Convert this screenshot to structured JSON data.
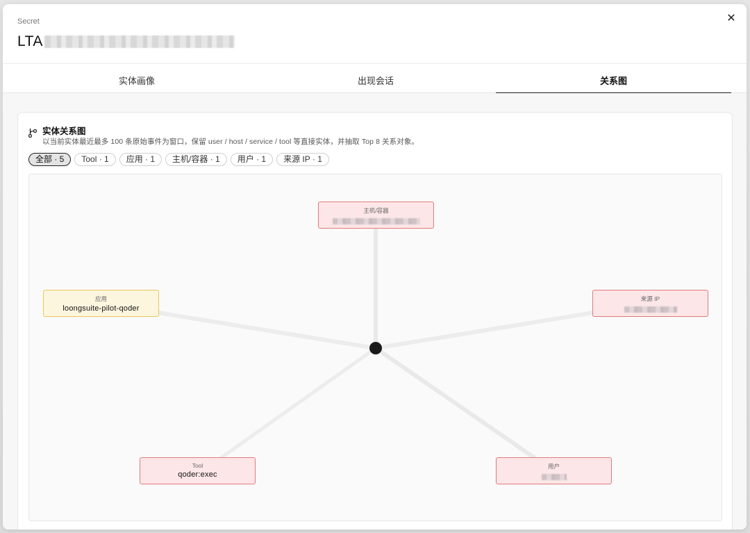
{
  "header": {
    "kind": "Secret",
    "title_prefix": "LTA",
    "close_glyph": "✕"
  },
  "tabs": [
    {
      "label": "实体画像"
    },
    {
      "label": "出现会话"
    },
    {
      "label": "关系图"
    }
  ],
  "active_tab": "关系图",
  "card": {
    "icon": "branch-icon",
    "title": "实体关系图",
    "description": "以当前实体最近最多 100 条原始事件为窗口，保留 user / host / service / tool 等直接实体，并抽取 Top 8 关系对象。"
  },
  "filters": [
    {
      "label": "全部 · 5",
      "active": true
    },
    {
      "label": "Tool · 1"
    },
    {
      "label": "应用 · 1"
    },
    {
      "label": "主机/容器 · 1"
    },
    {
      "label": "用户 · 1"
    },
    {
      "label": "来源 IP · 1"
    }
  ],
  "graph": {
    "nodes": {
      "host": {
        "type": "主机/容器",
        "value": ""
      },
      "app": {
        "type": "应用",
        "value": "loongsuite-pilot-qoder"
      },
      "ip": {
        "type": "来源 IP",
        "value": ""
      },
      "tool": {
        "type": "Tool",
        "value": "qoder:exec"
      },
      "user": {
        "type": "用户",
        "value": ""
      }
    },
    "colors": {
      "risk_border": "#e07a7a",
      "risk_fill": "#fde6e8",
      "app_border": "#e8c65a",
      "app_fill": "#fdf6df",
      "center": "#1a1a1a",
      "edge": "#e9e9e9"
    }
  }
}
